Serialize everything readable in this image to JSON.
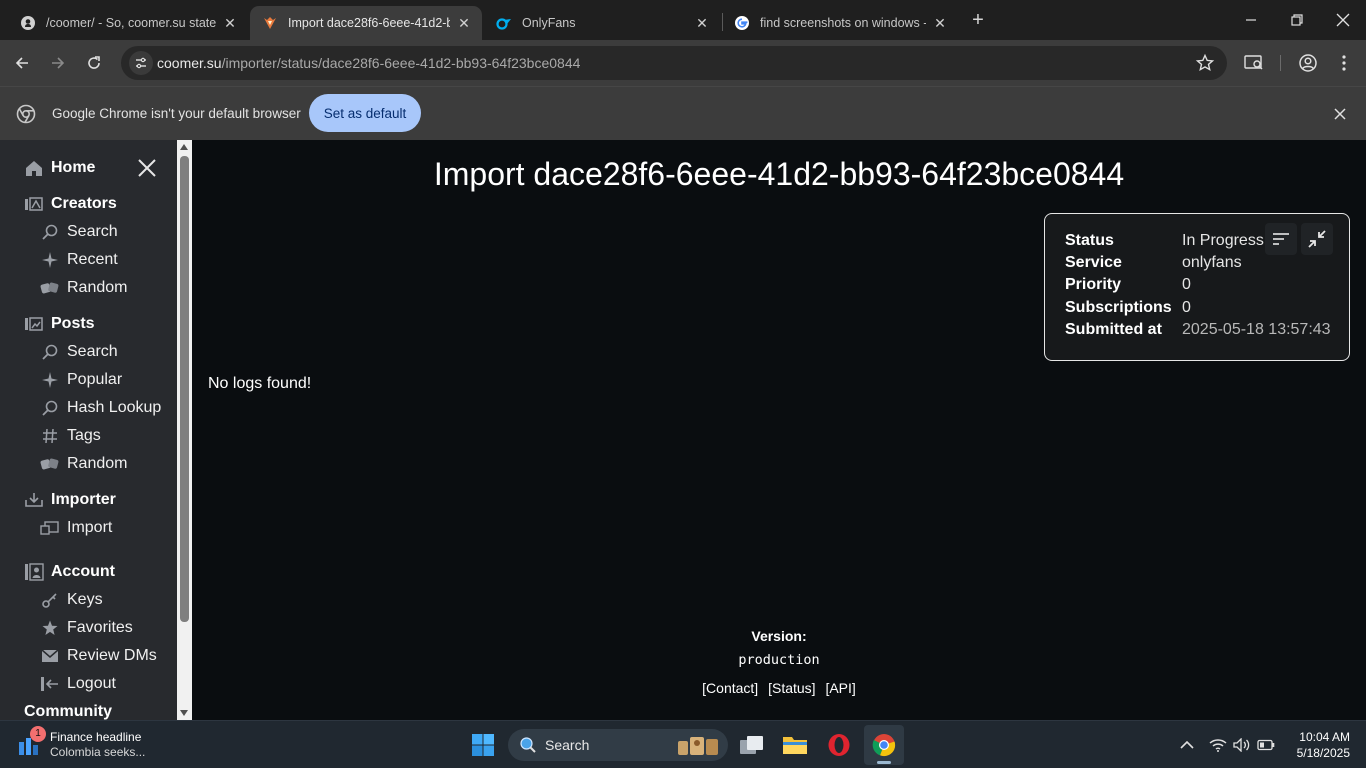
{
  "browser": {
    "tabs": [
      {
        "title": "/coomer/ - So, coomer.su state",
        "favicon": "github-icon"
      },
      {
        "title": "Import dace28f6-6eee-41d2-bb",
        "favicon": "coomer-icon",
        "active": true
      },
      {
        "title": "OnlyFans",
        "favicon": "onlyfans-icon"
      },
      {
        "title": "find screenshots on windows - G",
        "favicon": "google-icon"
      }
    ],
    "url_host": "coomer.su",
    "url_path": "/importer/status/dace28f6-6eee-41d2-bb93-64f23bce0844",
    "infobar_message": "Google Chrome isn't your default browser",
    "infobar_button": "Set as default"
  },
  "sidebar": {
    "home": "Home",
    "sections": [
      {
        "title": "Creators",
        "icon": "creators-icon",
        "items": [
          {
            "label": "Search",
            "icon": "search-icon"
          },
          {
            "label": "Recent",
            "icon": "sparkle-icon"
          },
          {
            "label": "Random",
            "icon": "dice-icon"
          }
        ]
      },
      {
        "title": "Posts",
        "icon": "posts-icon",
        "items": [
          {
            "label": "Search",
            "icon": "search-icon"
          },
          {
            "label": "Popular",
            "icon": "sparkle-icon"
          },
          {
            "label": "Hash Lookup",
            "icon": "search-icon"
          },
          {
            "label": "Tags",
            "icon": "hash-icon"
          },
          {
            "label": "Random",
            "icon": "dice-icon"
          }
        ]
      },
      {
        "title": "Importer",
        "icon": "importer-icon",
        "items": [
          {
            "label": "Import",
            "icon": "import-icon"
          }
        ]
      },
      {
        "title": "Account",
        "icon": "account-icon",
        "items": [
          {
            "label": "Keys",
            "icon": "key-icon"
          },
          {
            "label": "Favorites",
            "icon": "star-icon"
          },
          {
            "label": "Review DMs",
            "icon": "mail-icon"
          },
          {
            "label": "Logout",
            "icon": "logout-icon"
          }
        ]
      }
    ],
    "community": "Community"
  },
  "main": {
    "title": "Import dace28f6-6eee-41d2-bb93-64f23bce0844",
    "status_card": {
      "rows": [
        {
          "key": "Status",
          "value": "In Progress"
        },
        {
          "key": "Service",
          "value": "onlyfans"
        },
        {
          "key": "Priority",
          "value": "0"
        },
        {
          "key": "Subscriptions",
          "value": "0"
        },
        {
          "key": "Submitted at",
          "value": "2025-05-18 13:57:43"
        }
      ]
    },
    "no_logs": "No logs found!",
    "footer": {
      "version_label": "Version:",
      "version_value": "production",
      "links": [
        "[Contact]",
        "[Status]",
        "[API]"
      ]
    }
  },
  "taskbar": {
    "news_title": "Finance headline",
    "news_sub": "Colombia seeks...",
    "news_badge": "1",
    "search_label": "Search",
    "time": "10:04 AM",
    "date": "5/18/2025"
  },
  "colors": {
    "page_bg": "#0a0d10",
    "sidebar_bg": "#282a2e",
    "accent_button": "#a8c7fa"
  }
}
